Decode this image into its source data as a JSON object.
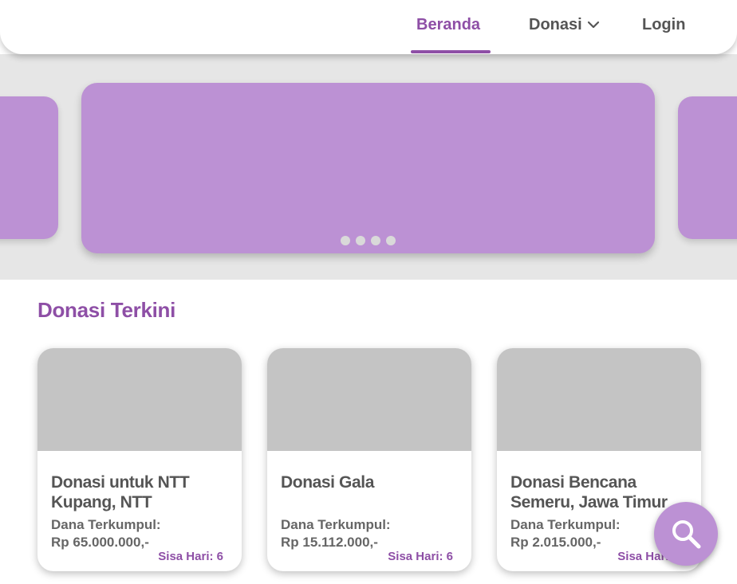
{
  "nav": {
    "home_label": "Beranda",
    "donasi_label": "Donasi",
    "login_label": "Login",
    "accent_color": "#8e4fa6"
  },
  "hero": {
    "slide_color": "#bc91d4",
    "indicator_count": 4
  },
  "section": {
    "title": "Donasi Terkini"
  },
  "cards": [
    {
      "title": "Donasi untuk NTT\nKupang, NTT",
      "raised_label": "Dana Terkumpul:",
      "raised_amount": "Rp 65.000.000,-",
      "days_left": "Sisa Hari: 6"
    },
    {
      "title": "Donasi Gala",
      "raised_label": "Dana Terkumpul:",
      "raised_amount": "Rp 15.112.000,-",
      "days_left": "Sisa Hari: 6"
    },
    {
      "title": "Donasi Bencana\nSemeru, Jawa Timur",
      "raised_label": "Dana Terkumpul:",
      "raised_amount": "Rp 2.015.000,-",
      "days_left": "Sisa Hari: 6"
    }
  ],
  "fab": {
    "icon": "search-icon",
    "color": "#bc91d4"
  }
}
